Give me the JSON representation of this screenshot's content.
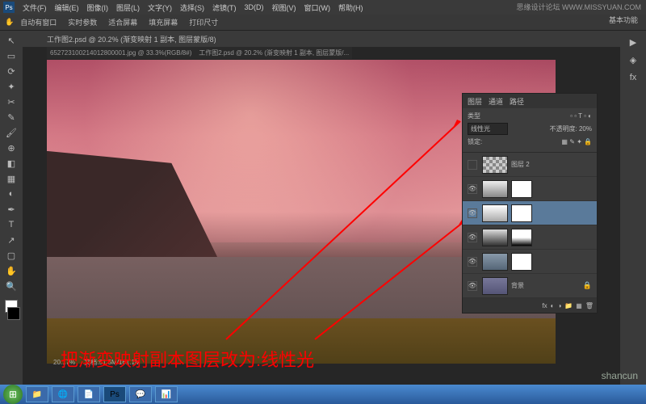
{
  "watermarks": {
    "top": "思缘设计论坛 WWW.MISSYUAN.COM",
    "bottom": "shancun"
  },
  "workspace_label": "基本功能",
  "menubar": [
    "文件(F)",
    "编辑(E)",
    "图像(I)",
    "图层(L)",
    "文字(Y)",
    "选择(S)",
    "滤镜(T)",
    "3D(D)",
    "视图(V)",
    "窗口(W)",
    "帮助(H)"
  ],
  "toolbar": {
    "autoselect": "自动有窗口",
    "show": "实时参数",
    "item3": "适合屏幕",
    "item4": "填充屏幕",
    "item5": "打印尺寸"
  },
  "tabs": {
    "main": "工作图2.psd @ 20.2% (渐变映射 1 副本, 图层蒙版/8)",
    "sub1": "652723100214012800001.jpg @ 33.3%(RGB/8#)",
    "sub2": "工作图2.psd @ 20.2% (渐变映射 1 副本, 图层蒙版/..."
  },
  "layers_panel": {
    "tabs": [
      "图层",
      "通道",
      "路径"
    ],
    "kind_label": "类型",
    "blend_mode": "线性光",
    "opacity_label": "不透明度:",
    "opacity_value": "20%",
    "lock_label": "锁定:",
    "layers": [
      {
        "name": "图层 2",
        "checker": true
      },
      {
        "name": "",
        "adj": true
      },
      {
        "name": "",
        "adj": true,
        "active": true
      },
      {
        "name": "",
        "adj": true
      },
      {
        "name": "",
        "adj": true
      },
      {
        "name": "背景",
        "bg": true
      }
    ]
  },
  "status": {
    "zoom": "20.17%",
    "size": "文档:51.5M/161.1M"
  },
  "annotation": "把渐变映射副本图层改为:线性光",
  "taskbar_icons": [
    "📁",
    "🌐",
    "📄",
    "Ps",
    "💬",
    "📊"
  ]
}
